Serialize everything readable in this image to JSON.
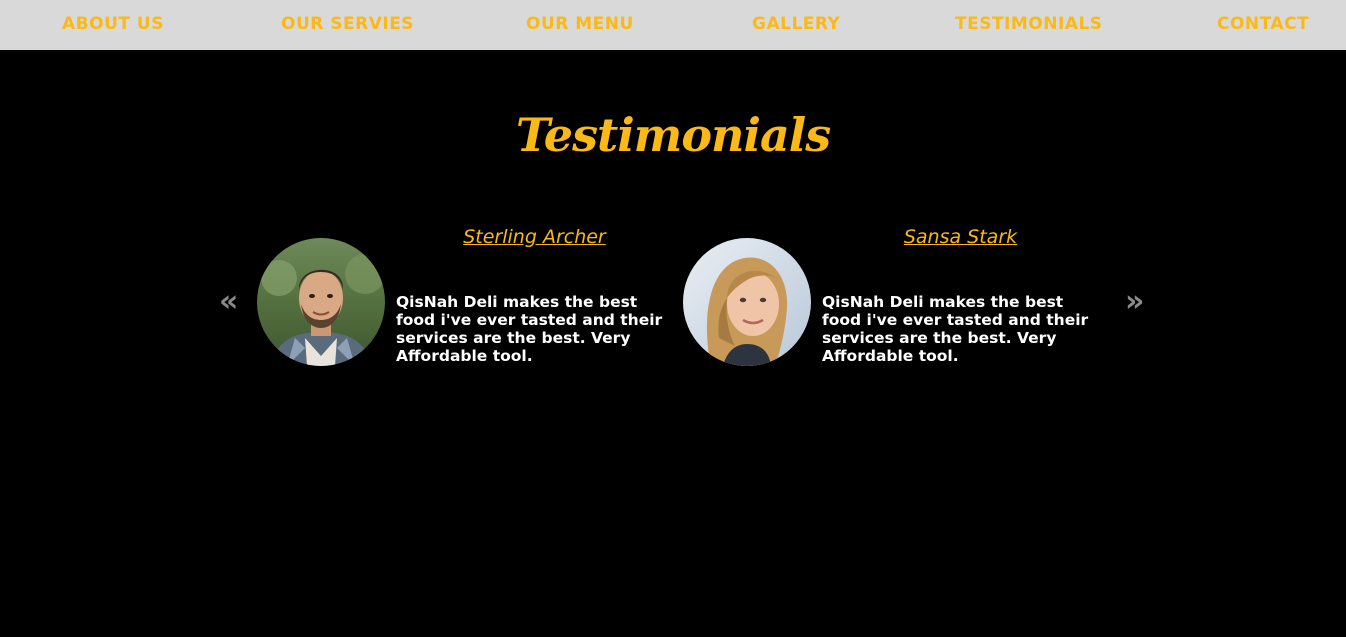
{
  "nav": {
    "items": [
      {
        "label": "ABOUT US"
      },
      {
        "label": "OUR SERVIES"
      },
      {
        "label": "OUR MENU"
      },
      {
        "label": "GALLERY"
      },
      {
        "label": "TESTIMONIALS"
      },
      {
        "label": "CONTACT"
      }
    ]
  },
  "testimonials": {
    "title": "Testimonials",
    "prev_arrow": "«",
    "next_arrow": "»",
    "cards": [
      {
        "name": "Sterling Archer",
        "quote": "QisNah Deli makes the best food i've ever tasted and their services are the best. Very Affordable tool."
      },
      {
        "name": "Sansa Stark",
        "quote": "QisNah Deli makes the best food i've ever tasted and their services are the best. Very Affordable tool."
      }
    ]
  },
  "colors": {
    "accent": "#fbb917",
    "nav_background": "#d9d9d9",
    "page_background": "#000000",
    "arrow": "#8a8a8a",
    "text": "#ffffff"
  }
}
